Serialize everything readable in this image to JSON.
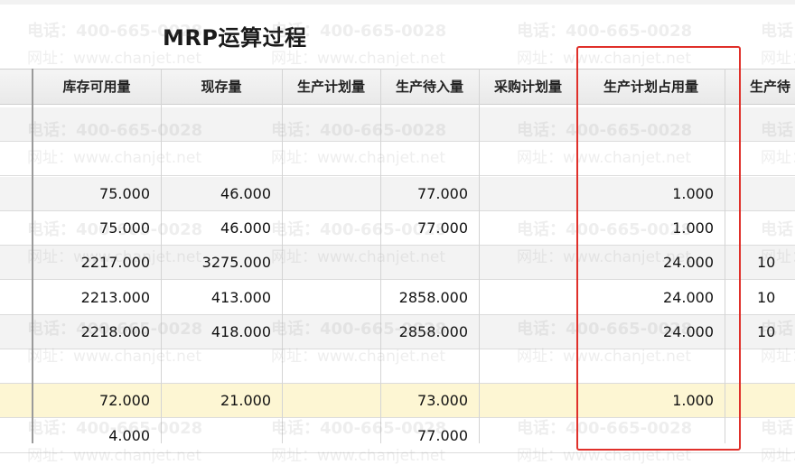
{
  "page": {
    "title": "MRP运算过程"
  },
  "table": {
    "headers": [
      "库存可用量",
      "现存量",
      "生产计划量",
      "生产待入量",
      "采购计划量",
      "生产计划占用量",
      "生产待"
    ],
    "rows": [
      [
        "",
        "",
        "",
        "",
        "",
        "",
        ""
      ],
      [
        "",
        "",
        "",
        "",
        "",
        "",
        ""
      ],
      [
        "75.000",
        "46.000",
        "",
        "77.000",
        "",
        "1.000",
        ""
      ],
      [
        "75.000",
        "46.000",
        "",
        "77.000",
        "",
        "1.000",
        ""
      ],
      [
        "2217.000",
        "3275.000",
        "",
        "",
        "",
        "24.000",
        "10"
      ],
      [
        "2213.000",
        "413.000",
        "",
        "2858.000",
        "",
        "24.000",
        "10"
      ],
      [
        "2218.000",
        "418.000",
        "",
        "2858.000",
        "",
        "24.000",
        "10"
      ],
      [
        "",
        "",
        "",
        "",
        "",
        "",
        ""
      ],
      [
        "72.000",
        "21.000",
        "",
        "73.000",
        "",
        "1.000",
        ""
      ],
      [
        "4.000",
        "",
        "",
        "77.000",
        "",
        "",
        ""
      ]
    ],
    "highlighted_row_index": 8
  },
  "watermark": {
    "phone": "电话：400-665-0028",
    "site": "网址：www.chanjet.net"
  },
  "colors": {
    "highlight_box": "#e0302a",
    "highlight_row": "#fdf6d3"
  }
}
